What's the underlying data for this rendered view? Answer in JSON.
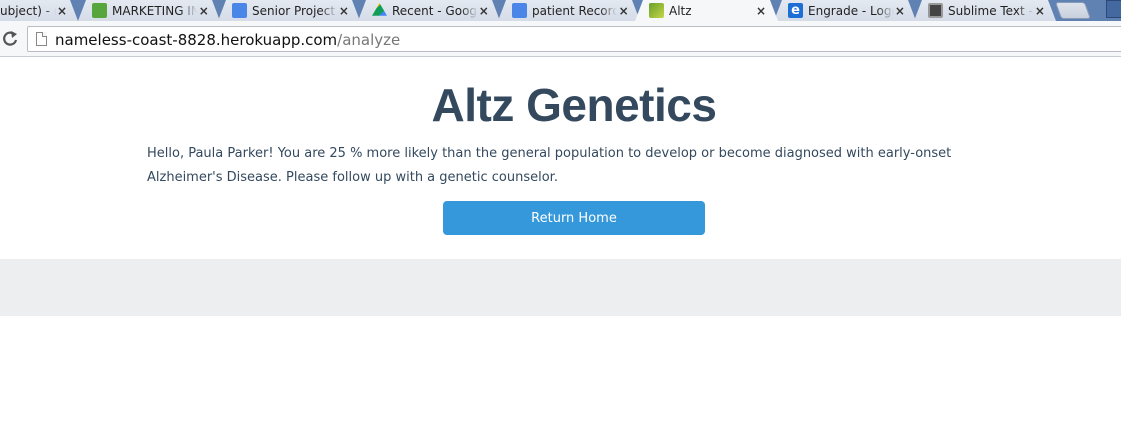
{
  "browser": {
    "tabs": [
      {
        "label": "ubject) - ro",
        "favicon": "mail-icon"
      },
      {
        "label": "MARKETING INT",
        "favicon": "tag-icon"
      },
      {
        "label": "Senior Project In",
        "favicon": "google-docs-icon"
      },
      {
        "label": "Recent - Google",
        "favicon": "google-drive-icon"
      },
      {
        "label": "patient Records",
        "favicon": "google-docs-icon"
      },
      {
        "label": "Altz",
        "favicon": "altz-icon",
        "active": true
      },
      {
        "label": "Engrade - Logou",
        "favicon": "engrade-icon"
      },
      {
        "label": "Sublime Text - D",
        "favicon": "sublime-icon"
      }
    ],
    "close_glyph": "×",
    "engrade_letter": "e",
    "url_host": "nameless-coast-8828.herokuapp.com",
    "url_path": "/analyze"
  },
  "page": {
    "title": "Altz Genetics",
    "message": "Hello, Paula Parker! You are 25 % more likely than the general population to develop or become diagnosed with early-onset Alzheimer's Disease. Please follow up with a genetic counselor.",
    "return_button_label": "Return Home"
  },
  "colors": {
    "title": "#34495e",
    "button": "#3498db",
    "footer_band": "#eceef0"
  }
}
